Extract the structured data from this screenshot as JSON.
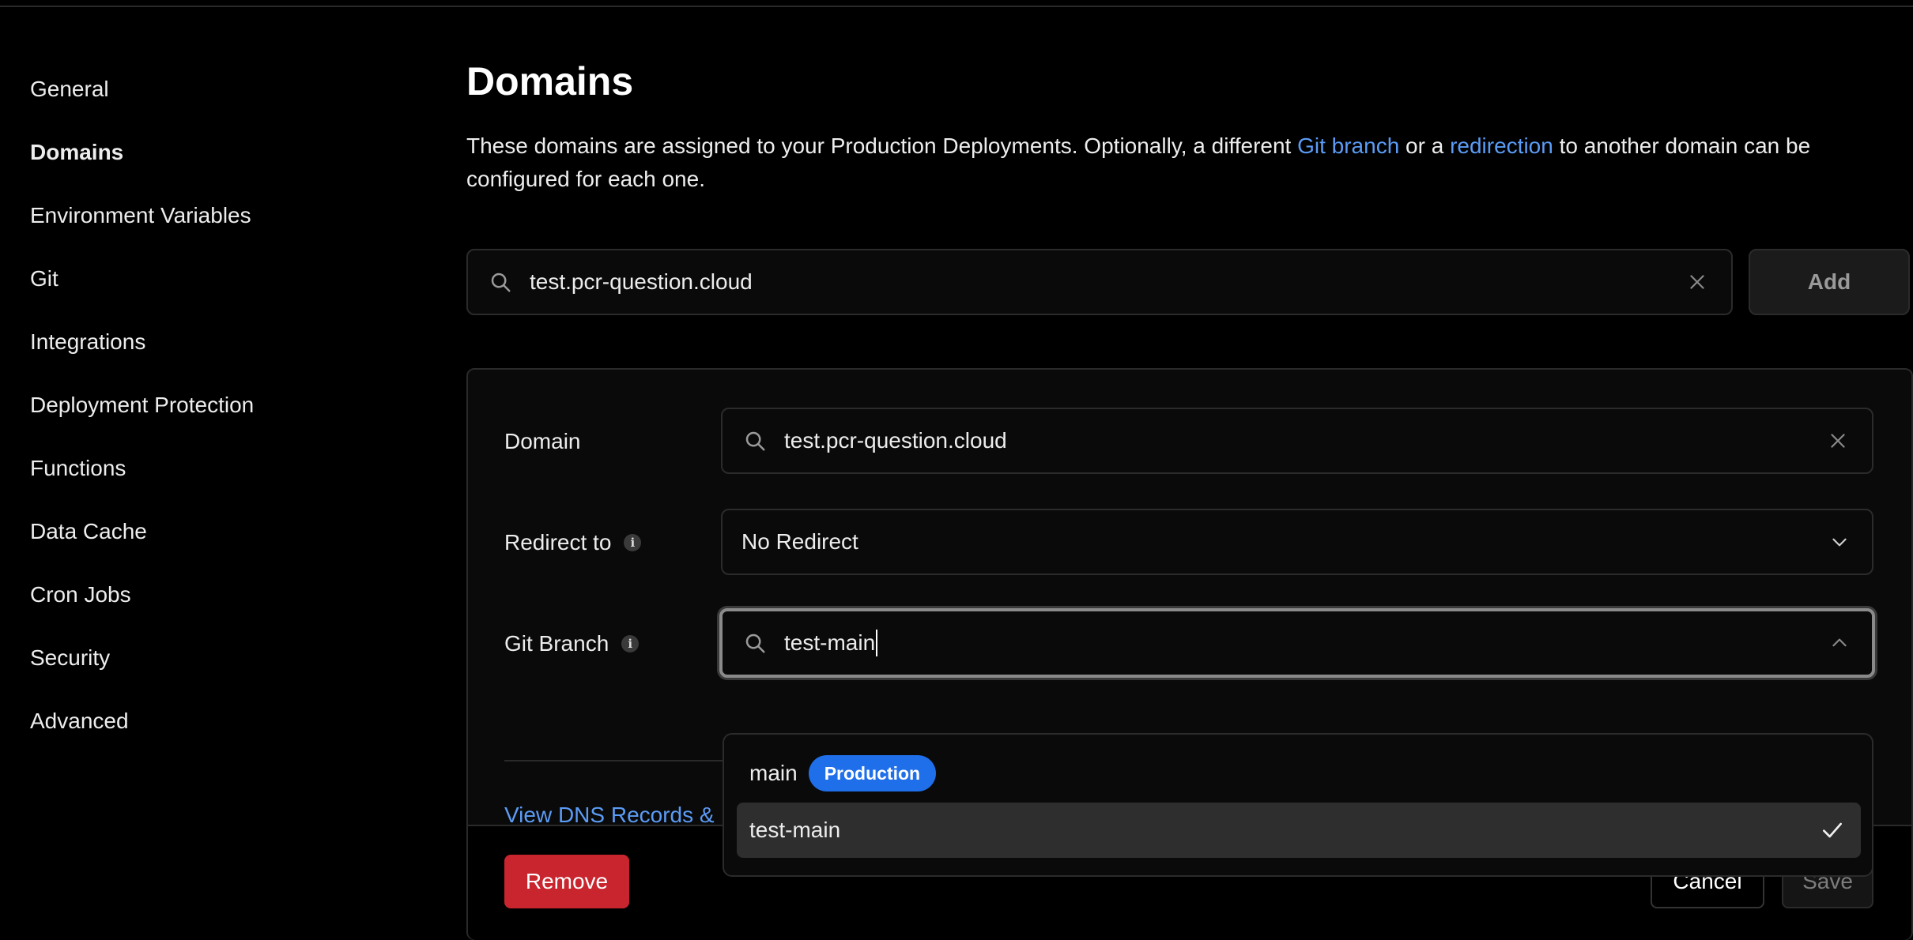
{
  "sidebar": {
    "items": [
      {
        "label": "General"
      },
      {
        "label": "Domains"
      },
      {
        "label": "Environment Variables"
      },
      {
        "label": "Git"
      },
      {
        "label": "Integrations"
      },
      {
        "label": "Deployment Protection"
      },
      {
        "label": "Functions"
      },
      {
        "label": "Data Cache"
      },
      {
        "label": "Cron Jobs"
      },
      {
        "label": "Security"
      },
      {
        "label": "Advanced"
      }
    ],
    "active": "Domains"
  },
  "main": {
    "title": "Domains",
    "description": {
      "part1": "These domains are assigned to your Production Deployments. Optionally, a different ",
      "link1": "Git branch",
      "part2": " or a ",
      "link2": "redirection",
      "part3": " to another domain can be configured for each one."
    },
    "search": {
      "value": "test.pcr-question.cloud"
    },
    "add_label": "Add"
  },
  "form": {
    "domain_label": "Domain",
    "domain_value": "test.pcr-question.cloud",
    "redirect_label": "Redirect to",
    "redirect_value": "No Redirect",
    "git_branch_label": "Git Branch",
    "git_branch_value": "test-main",
    "dns_link": "View DNS Records &",
    "remove_label": "Remove",
    "cancel_label": "Cancel",
    "save_label": "Save"
  },
  "dropdown": {
    "options": [
      {
        "label": "main",
        "badge": "Production",
        "selected": false
      },
      {
        "label": "test-main",
        "selected": true
      }
    ]
  },
  "colors": {
    "link": "#5b9cf6",
    "badge": "#1f6feb",
    "danger": "#c9252e"
  },
  "icons": [
    "search-icon",
    "close-icon",
    "chevron-down-icon",
    "chevron-up-icon",
    "info-icon",
    "check-icon"
  ]
}
